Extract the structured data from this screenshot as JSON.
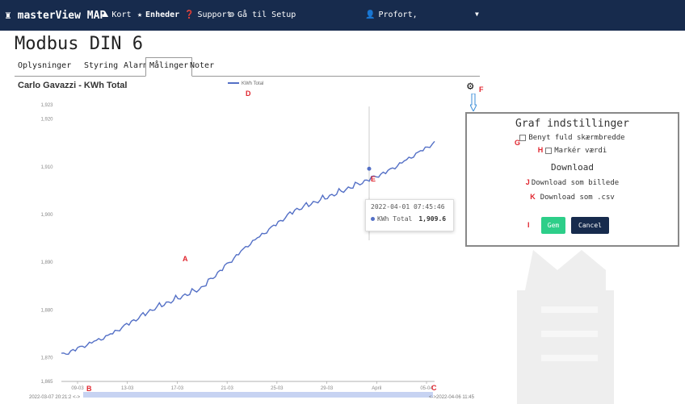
{
  "nav": {
    "brand": "masterView MAP",
    "items": [
      {
        "icon": "map-icon",
        "label": "Kort",
        "bold": false
      },
      {
        "icon": "star-icon",
        "label": "Enheder",
        "bold": true
      },
      {
        "icon": "help-icon",
        "label": "Support",
        "bold": false
      },
      {
        "icon": "cogs-icon",
        "label": "Gå til Setup",
        "bold": false
      }
    ],
    "user": "Profort,"
  },
  "page_title": "Modbus DIN 6",
  "tabs": [
    {
      "label": "Oplysninger",
      "active": false
    },
    {
      "label": "Styring",
      "active": false
    },
    {
      "label": "Alarmer",
      "active": false
    },
    {
      "label": "Målinger",
      "active": true
    },
    {
      "label": "Noter",
      "active": false
    }
  ],
  "chart_title": "Carlo Gavazzi - KWh Total",
  "legend_label": "KWh Total",
  "annotations": {
    "A": "A",
    "B": "B",
    "C": "C",
    "D": "D",
    "E": "E",
    "F": "F",
    "G": "G",
    "H": "H",
    "I": "I",
    "J": "J",
    "K": "K"
  },
  "tooltip": {
    "date": "2022-04-01 07:45:46",
    "series": "KWh Total",
    "value": "1,909.6"
  },
  "slider": {
    "start_label": "2022-03-07 20:21:2",
    "end_label": "2022-04-06 11:45"
  },
  "settings": {
    "title": "Graf indstillinger",
    "full_width": "Benyt fuld skærmbredde",
    "mark_value": "Markér værdi",
    "download_title": "Download",
    "download_image": "Download som billede",
    "download_csv": "Download som .csv",
    "save": "Gem",
    "cancel": "Cancel"
  },
  "colors": {
    "navbar": "#172b4d",
    "series": "#5470c6",
    "annotation": "#e0252e",
    "save": "#2dce89"
  },
  "chart_data": {
    "type": "line",
    "title": "Carlo Gavazzi - KWh Total",
    "series": [
      {
        "name": "KWh Total",
        "color": "#5470c6"
      }
    ],
    "x": [
      "09-03",
      "13-03",
      "17-03",
      "21-03",
      "25-03",
      "29-03",
      "April",
      "05-04"
    ],
    "y": [
      1870.4,
      1874.5,
      1880.3,
      1884.5,
      1893.5,
      1900.8,
      1904.8,
      1909.0,
      1915.0
    ],
    "yticks": [
      "1,865",
      "1,870",
      "1,880",
      "1,890",
      "1,900",
      "1,910",
      "1,920",
      "1,923"
    ],
    "ylim": [
      1865,
      1923
    ],
    "highlight": {
      "x": "2022-04-01 07:45:46",
      "y": 1909.6
    },
    "grid": false
  }
}
